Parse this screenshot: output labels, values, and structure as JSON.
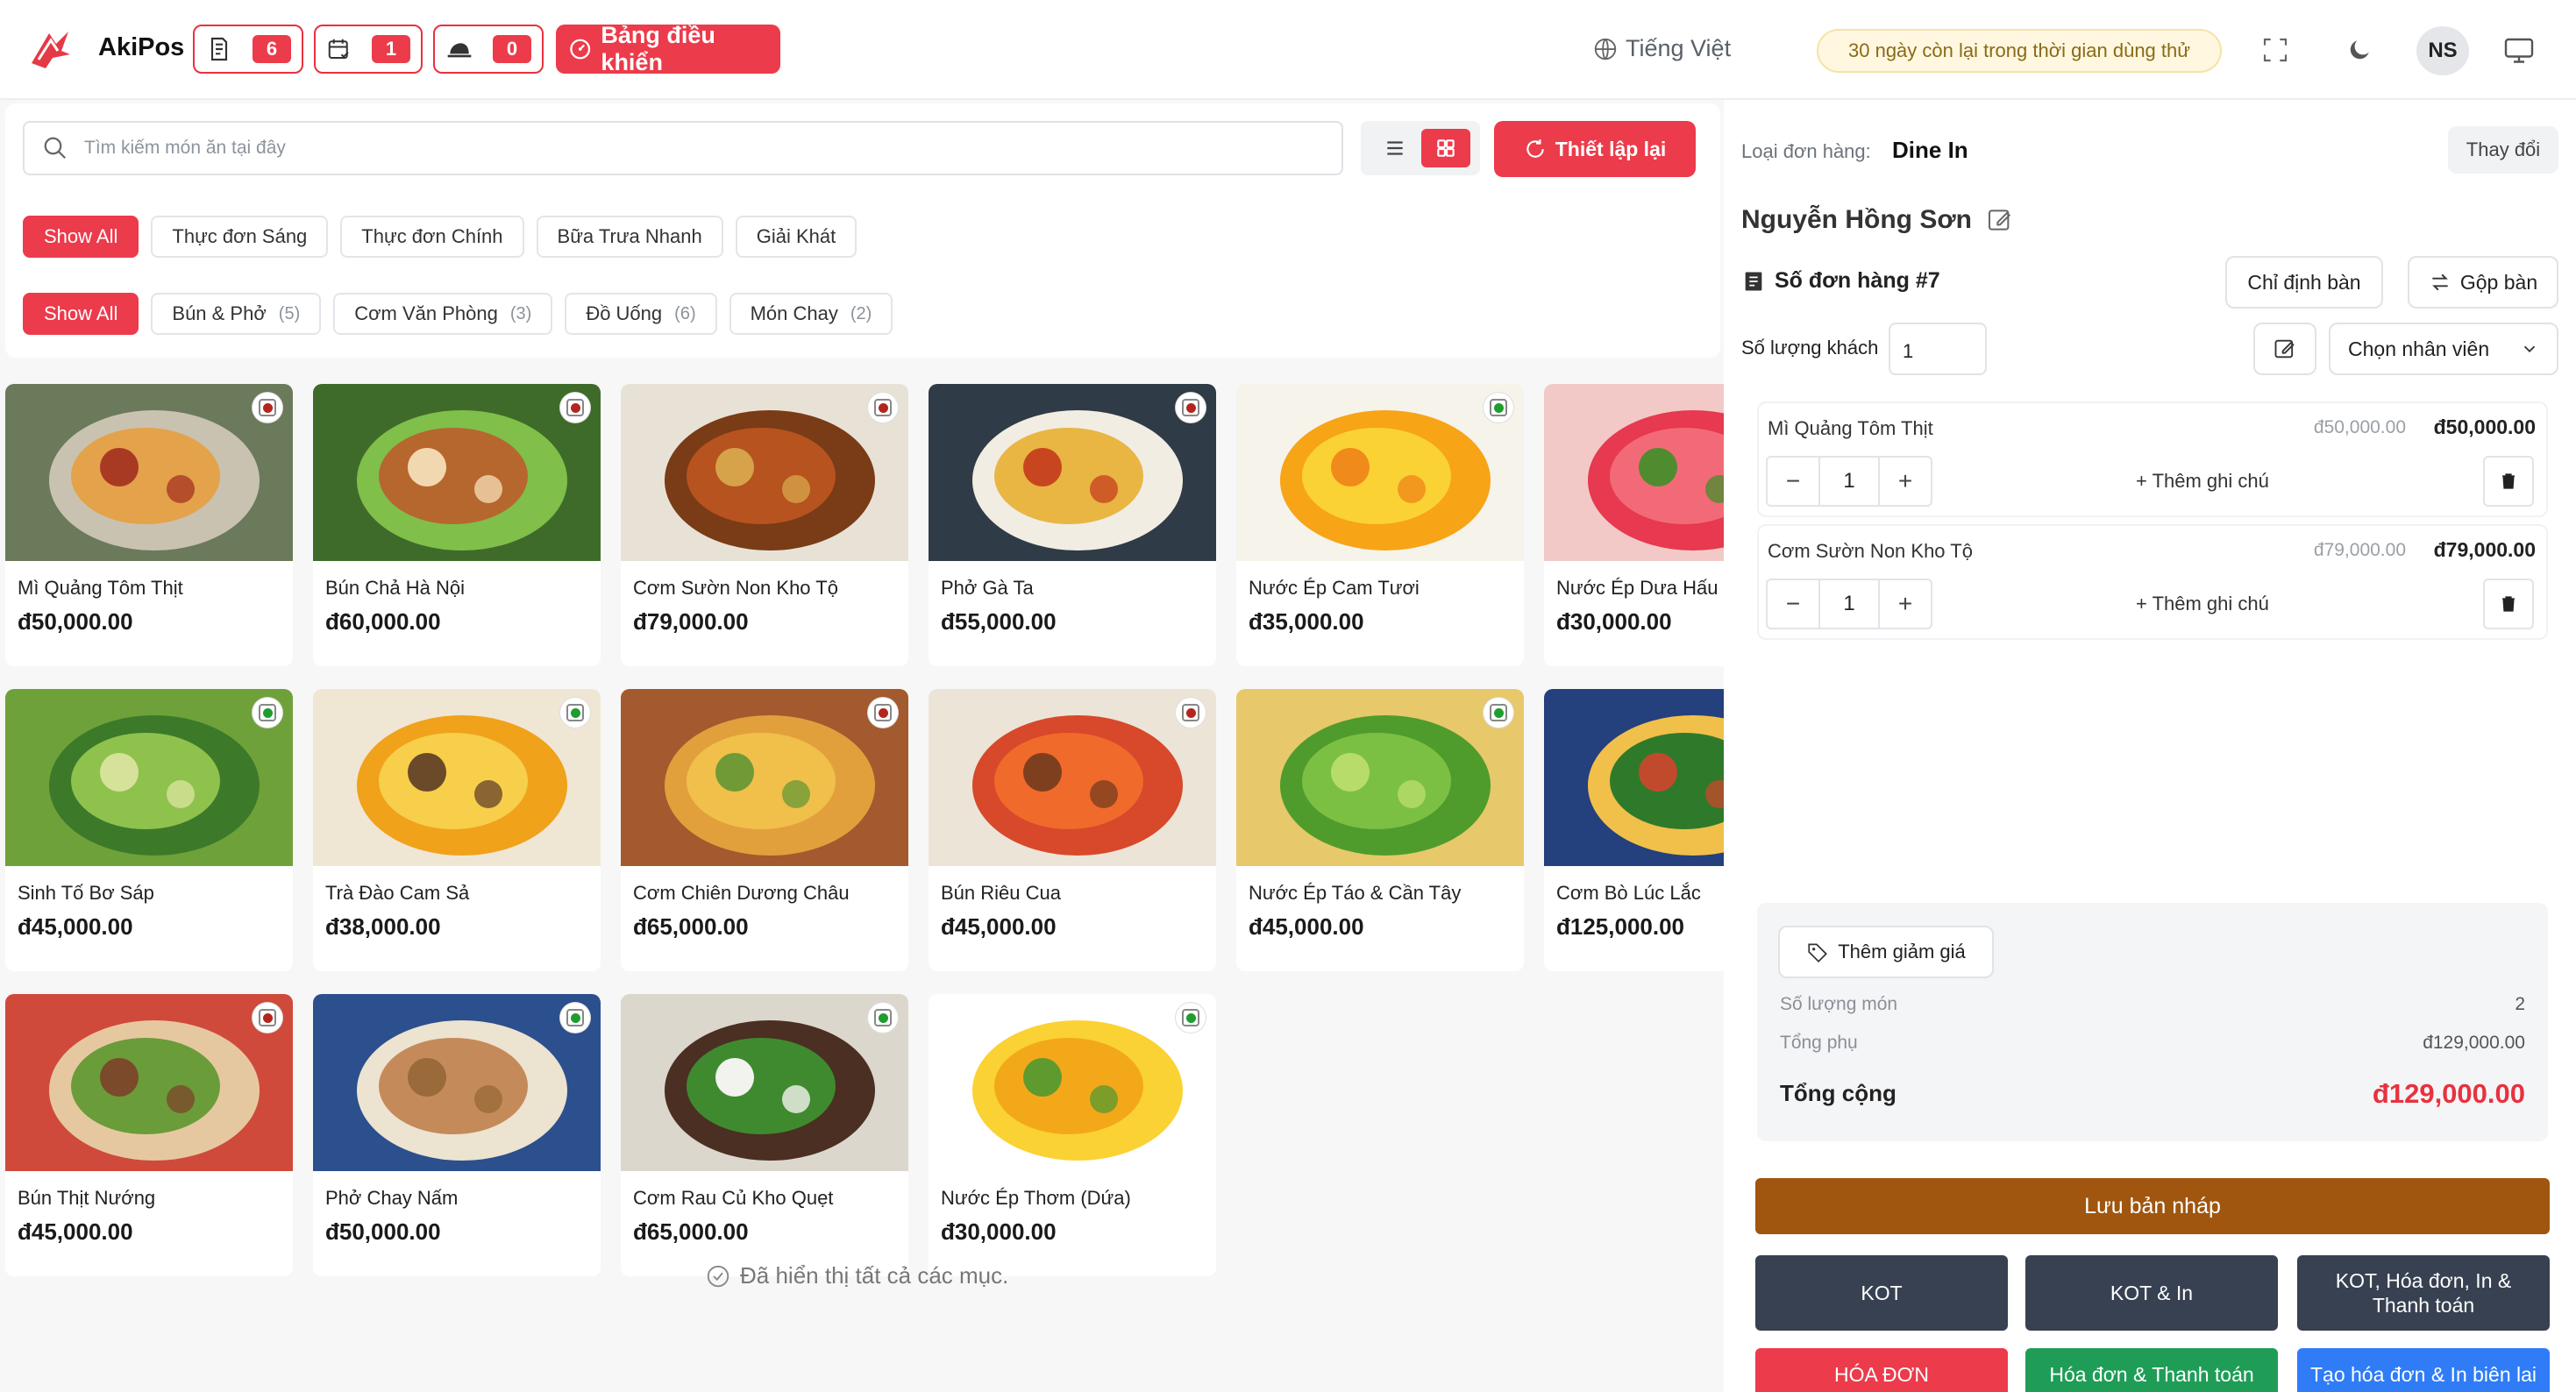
{
  "header": {
    "app_name": "AkiPos",
    "counters": [
      {
        "icon": "receipt-icon",
        "count": "6"
      },
      {
        "icon": "calendar-check-icon",
        "count": "1"
      },
      {
        "icon": "delivery-icon",
        "count": "0"
      }
    ],
    "dashboard_label": "Bảng điều khiển",
    "language": "Tiếng Việt",
    "trial_text": "30 ngày còn lại trong thời gian dùng thử",
    "avatar": "NS"
  },
  "search": {
    "placeholder": "Tìm kiếm món ăn tại đây"
  },
  "reset_label": "Thiết lập lại",
  "menus": [
    "Show All",
    "Thực đơn Sáng",
    "Thực đơn Chính",
    "Bữa Trưa Nhanh",
    "Giải Khát"
  ],
  "categories": [
    {
      "label": "Show All",
      "count": ""
    },
    {
      "label": "Bún & Phở",
      "count": "(5)"
    },
    {
      "label": "Cơm Văn Phòng",
      "count": "(3)"
    },
    {
      "label": "Đồ Uống",
      "count": "(6)"
    },
    {
      "label": "Món Chay",
      "count": "(2)"
    }
  ],
  "items": [
    {
      "name": "Mì Quảng Tôm Thịt",
      "price": "đ50,000.00",
      "veg": false
    },
    {
      "name": "Bún Chả Hà Nội",
      "price": "đ60,000.00",
      "veg": false
    },
    {
      "name": "Cơm Sườn Non Kho Tộ",
      "price": "đ79,000.00",
      "veg": false
    },
    {
      "name": "Phở Gà Ta",
      "price": "đ55,000.00",
      "veg": false
    },
    {
      "name": "Nước Ép Cam Tươi",
      "price": "đ35,000.00",
      "veg": true
    },
    {
      "name": "Nước Ép Dưa Hấu",
      "price": "đ30,000.00",
      "veg": true
    },
    {
      "name": "Sinh Tố Bơ Sáp",
      "price": "đ45,000.00",
      "veg": true
    },
    {
      "name": "Trà Đào Cam Sả",
      "price": "đ38,000.00",
      "veg": true
    },
    {
      "name": "Cơm Chiên Dương Châu",
      "price": "đ65,000.00",
      "veg": false
    },
    {
      "name": "Bún Riêu Cua",
      "price": "đ45,000.00",
      "veg": false
    },
    {
      "name": "Nước Ép Táo & Cần Tây",
      "price": "đ45,000.00",
      "veg": true
    },
    {
      "name": "Cơm Bò Lúc Lắc",
      "price": "đ125,000.00",
      "veg": false
    },
    {
      "name": "Bún Thịt Nướng",
      "price": "đ45,000.00",
      "veg": false
    },
    {
      "name": "Phở Chay Nấm",
      "price": "đ50,000.00",
      "veg": true
    },
    {
      "name": "Cơm Rau Củ Kho Quẹt",
      "price": "đ65,000.00",
      "veg": true
    },
    {
      "name": "Nước Ép Thơm (Dứa)",
      "price": "đ30,000.00",
      "veg": true
    }
  ],
  "all_shown": "Đã hiển thị tất cả các mục.",
  "order": {
    "type_label": "Loại đơn hàng:",
    "type_value": "Dine In",
    "change_label": "Thay đổi",
    "customer": "Nguyễn Hồng Sơn",
    "order_no": "Số đơn hàng #7",
    "assign_table": "Chỉ định bàn",
    "merge_table": "Gộp bàn",
    "guests_label": "Số lượng khách",
    "guests_value": "1",
    "staff_placeholder": "Chọn nhân viên",
    "lines": [
      {
        "name": "Mì Quảng Tôm Thịt",
        "unit": "đ50,000.00",
        "total": "đ50,000.00",
        "qty": "1",
        "note": "+ Thêm ghi chú"
      },
      {
        "name": "Cơm Sườn Non Kho Tộ",
        "unit": "đ79,000.00",
        "total": "đ79,000.00",
        "qty": "1",
        "note": "+ Thêm ghi chú"
      }
    ],
    "discount_label": "Thêm giảm giá",
    "item_count_label": "Số lượng món",
    "item_count": "2",
    "subtotal_label": "Tổng phụ",
    "subtotal": "đ129,000.00",
    "total_label": "Tổng cộng",
    "total": "đ129,000.00",
    "save_draft": "Lưu bản nháp",
    "kot": "KOT",
    "kot_print": "KOT & In",
    "kot_invoice": "KOT, Hóa đơn, In & Thanh toán",
    "invoice": "HÓA ĐƠN",
    "invoice_pay": "Hóa đơn & Thanh toán",
    "invoice_receipt": "Tạo hóa đơn & In biên lai"
  },
  "colors": {
    "accent": "#ec3b4b",
    "draft": "#a0560f",
    "dark": "#374151",
    "green": "#1f9d57",
    "blue": "#2f7cf6"
  }
}
